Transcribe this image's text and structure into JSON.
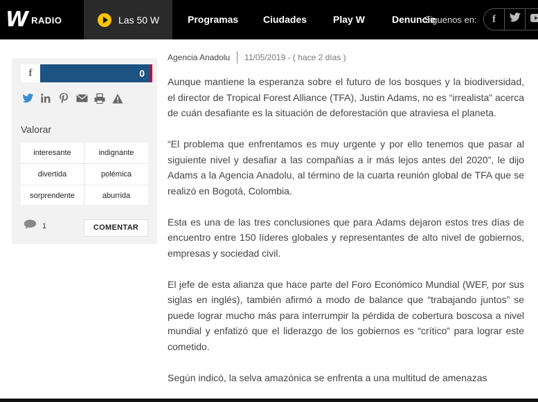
{
  "header": {
    "logo_text": "W",
    "logo_sub": "RADIO",
    "live_label": "Las 50 W",
    "nav": [
      "Programas",
      "Ciudades",
      "Play W",
      "Denuncie"
    ],
    "follow_label": "Síguenos en:",
    "social_icons": [
      "facebook-icon",
      "twitter-icon",
      "youtube-icon"
    ],
    "accent_color": "#f6c506"
  },
  "sidebar": {
    "facebook_label": "f",
    "facebook_count": "0",
    "share_icons": [
      "twitter-icon",
      "linkedin-icon",
      "pinterest-icon",
      "email-icon",
      "print-icon",
      "report-icon"
    ],
    "valorar_title": "Valorar",
    "votes": [
      "interesante",
      "indignante",
      "divertida",
      "polémica",
      "sorprendente",
      "aburrida"
    ],
    "comment_count": "1",
    "comment_button": "COMENTAR"
  },
  "article": {
    "source": "Agencia Anadolu",
    "date": "11/05/2019 - ( hace 2 días )",
    "paragraphs": [
      "Aunque mantiene la esperanza sobre el futuro de los bosques y la biodiversidad, el director de Tropical Forest Alliance (TFA), Justin Adams, no es “irrealista” acerca de cuán desafiante es la situación de deforestación que atraviesa el planeta.",
      "“El problema que enfrentamos es muy urgente y por ello tenemos que pasar al siguiente nivel y desafiar a las compañías a ir más lejos antes del 2020”, le dijo Adams a la Agencia Anadolu, al término de la cuarta reunión global de TFA que se realizó en Bogotá, Colombia.",
      "Esta es una de las tres conclusiones que para Adams dejaron estos tres días de encuentro entre 150 líderes globales y representantes de alto nivel de gobiernos, empresas y sociedad civil.",
      "El jefe de esta alianza que hace parte del Foro Económico Mundial (WEF, por sus siglas en inglés), también afirmó a modo de balance que “trabajando juntos” se puede lograr mucho más para interrumpir la pérdida de cobertura boscosa a nivel mundial y enfatizó que el liderazgo de los gobiernos es “crítico” para lograr este cometido.",
      "Según indicó, la selva amazónica se enfrenta a una multitud de amenazas"
    ]
  }
}
